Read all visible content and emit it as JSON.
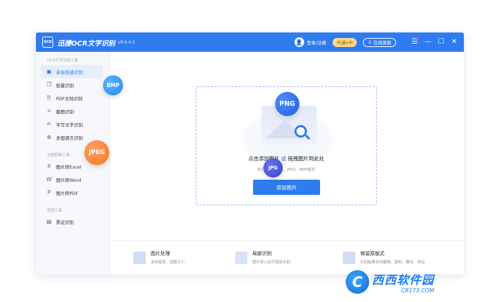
{
  "titlebar": {
    "logo_text": "OCR",
    "title": "迅捷OCR文字识别",
    "version": "v8.6.4.2",
    "login": "登录/注册",
    "vip": "开通VIP",
    "service": "在线客服",
    "accent": "#2f7bf0"
  },
  "sidebar": {
    "sections": [
      {
        "title": "OCR文字识别工具",
        "items": [
          {
            "label": "单张快速识别",
            "icon": "image-edit-icon",
            "glyph": "▣",
            "active": true
          },
          {
            "label": "批量识别",
            "icon": "layers-icon",
            "glyph": "❐"
          },
          {
            "label": "PDF文档识别",
            "icon": "pdf-icon",
            "glyph": "⎘"
          },
          {
            "label": "截图识别",
            "icon": "crop-icon",
            "glyph": "⌗"
          },
          {
            "label": "手写文字识别",
            "icon": "pen-icon",
            "glyph": "✍"
          },
          {
            "label": "多国语言识别",
            "icon": "globe-icon",
            "glyph": "⊕"
          }
        ]
      },
      {
        "title": "识图转换工具",
        "items": [
          {
            "label": "图片转Excel",
            "icon": "excel-icon",
            "glyph": "X"
          },
          {
            "label": "图片转Word",
            "icon": "word-icon",
            "glyph": "W"
          },
          {
            "label": "图片转PDF",
            "icon": "pdf-file-icon",
            "glyph": "P"
          }
        ]
      },
      {
        "title": "其他工具",
        "items": [
          {
            "label": "票证识别",
            "icon": "ticket-icon",
            "glyph": "▤"
          }
        ]
      }
    ]
  },
  "dropzone": {
    "title_part1": "点击添加图片",
    "title_or": "或",
    "title_part2": "拖拽图片到此处",
    "formats": "支持PNG、JPG、JPEG、BMP格式",
    "add_button": "添加图片"
  },
  "bubbles": {
    "bmp": "BMP",
    "png": "PNG",
    "jpeg": "JPEG",
    "jpg": "JPG"
  },
  "features": [
    {
      "title": "图片处理",
      "desc": "支持旋转、调整大小",
      "color": "#cfdcf3"
    },
    {
      "title": "局部识别",
      "desc": "图片导入后可局部识别",
      "color": "#d6e2f6"
    },
    {
      "title": "保留原版式",
      "desc": "识别结果支持编辑、复制、翻译、导出",
      "color": "#cfdcf3"
    }
  ],
  "watermark": {
    "logo": "C",
    "main": "西西软件园",
    "sub": "CR173.COM"
  }
}
